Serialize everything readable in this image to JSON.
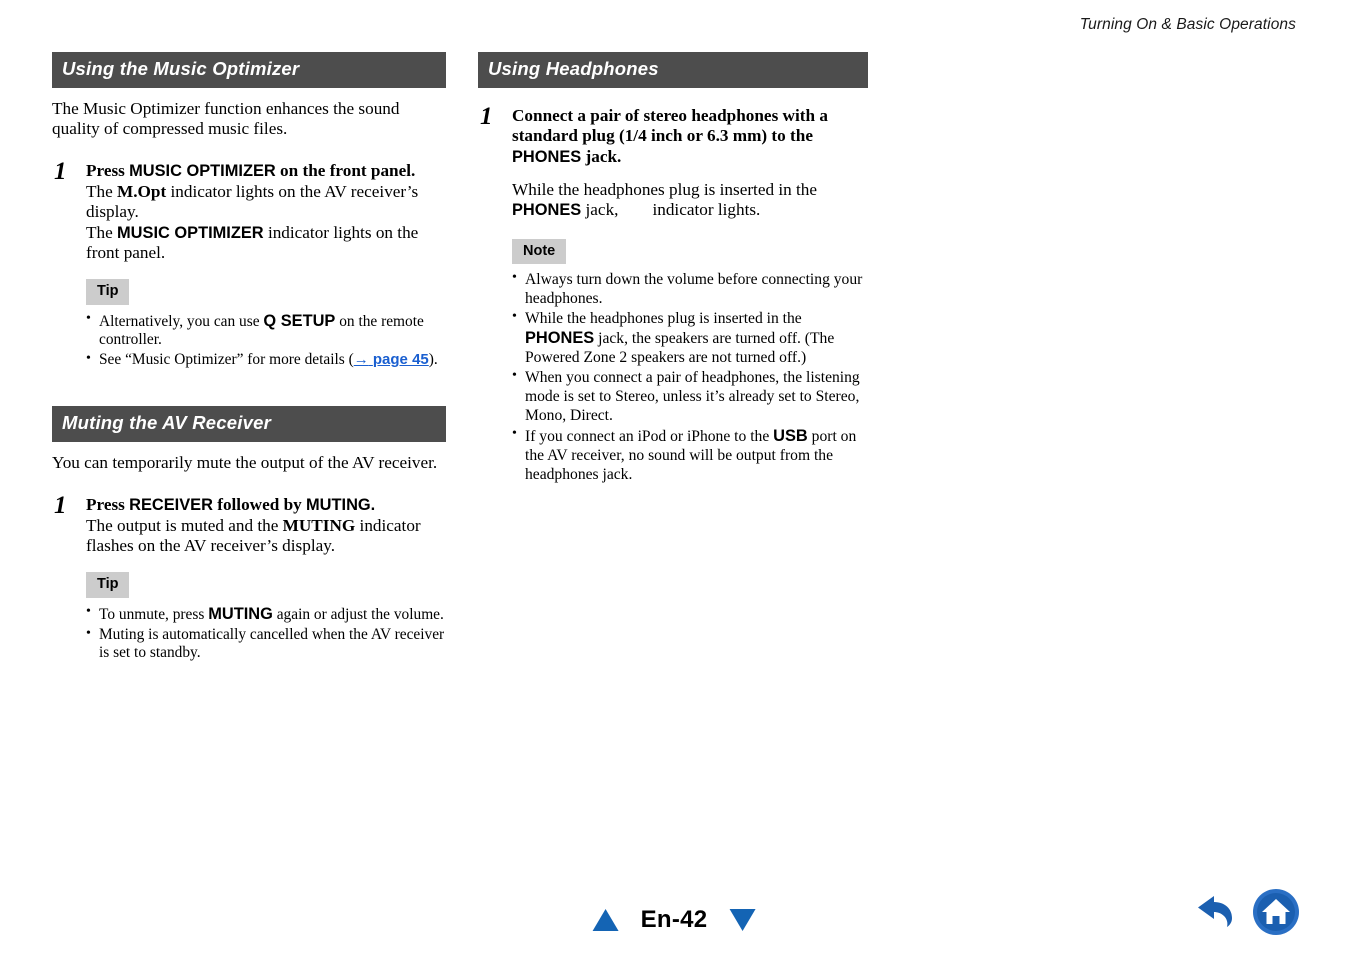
{
  "running_head": "Turning On & Basic Operations",
  "left_column": {
    "section1": {
      "heading": "Using the Music Optimizer",
      "intro": "The Music Optimizer function enhances the sound quality of compressed music files.",
      "step": {
        "number": "1",
        "title_pre": "Press ",
        "title_ctrl": "MUSIC OPTIMIZER",
        "title_post": " on the front panel.",
        "body1_pre": "The ",
        "body1_em": "M.Opt",
        "body1_post": " indicator lights on the AV receiver’s display.",
        "body2_pre": "The ",
        "body2_ctrl": "MUSIC OPTIMIZER",
        "body2_post": " indicator lights on the front panel."
      },
      "tip": {
        "label": "Tip",
        "bullet1_pre": "Alternatively, you can use ",
        "bullet1_ctrl": "Q SETUP",
        "bullet1_post": " on the remote controller.",
        "bullet2_pre": "See “Music Optimizer” for more details (",
        "bullet2_link_arrow": "→",
        "bullet2_link_text": "page 45",
        "bullet2_post": ")."
      }
    },
    "section2": {
      "heading": "Muting the AV Receiver",
      "intro": "You can temporarily mute the output of the AV receiver.",
      "step": {
        "number": "1",
        "title_pre": "Press ",
        "title_ctrl1": "RECEIVER",
        "title_mid": " followed by ",
        "title_ctrl2": "MUTING.",
        "body_pre": "The output is muted and the ",
        "body_em": "MUTING",
        "body_post": " indicator flashes on the AV receiver’s display."
      },
      "tip": {
        "label": "Tip",
        "bullet1_pre": "To unmute, press ",
        "bullet1_ctrl": "MUTING",
        "bullet1_post": " again or adjust the volume.",
        "bullet2": "Muting is automatically cancelled when the AV receiver is set to standby."
      }
    }
  },
  "right_column": {
    "section1": {
      "heading": "Using Headphones",
      "step": {
        "number": "1",
        "title_pre": "Connect a pair of stereo headphones with a standard plug (1/4 inch or 6.3 mm) to the ",
        "title_ctrl": "PHONES",
        "title_post": " jack.",
        "body_pre": "While the headphones plug is inserted in the ",
        "body_ctrl": "PHONES",
        "body_mid": " jack,",
        "body_post": "indicator lights."
      },
      "note": {
        "label": "Note",
        "bullet1": "Always turn down the volume before connecting your headphones.",
        "bullet2_pre": "While the headphones plug is inserted in the ",
        "bullet2_ctrl": "PHONES",
        "bullet2_post": " jack, the speakers are turned off. (The Powered Zone 2 speakers are not turned off.)",
        "bullet3": "When you connect a pair of headphones, the listening mode is set to Stereo, unless it’s already set to Stereo, Mono, Direct.",
        "bullet4_pre": "If you connect an iPod or iPhone to the ",
        "bullet4_ctrl": "USB",
        "bullet4_post": " port on the AV receiver, no sound will be output from the headphones jack."
      }
    }
  },
  "footer": {
    "page_label": "En-42",
    "prev_page_icon": "triangle-up-icon",
    "next_page_icon": "triangle-down-icon",
    "back_icon": "back-arrow-icon",
    "home_icon": "home-icon"
  },
  "colors": {
    "section_bar_bg": "#4d4d4d",
    "callout_bg": "#cccccc",
    "accent_blue": "#1464b4",
    "link_blue": "#1a5fd0"
  }
}
